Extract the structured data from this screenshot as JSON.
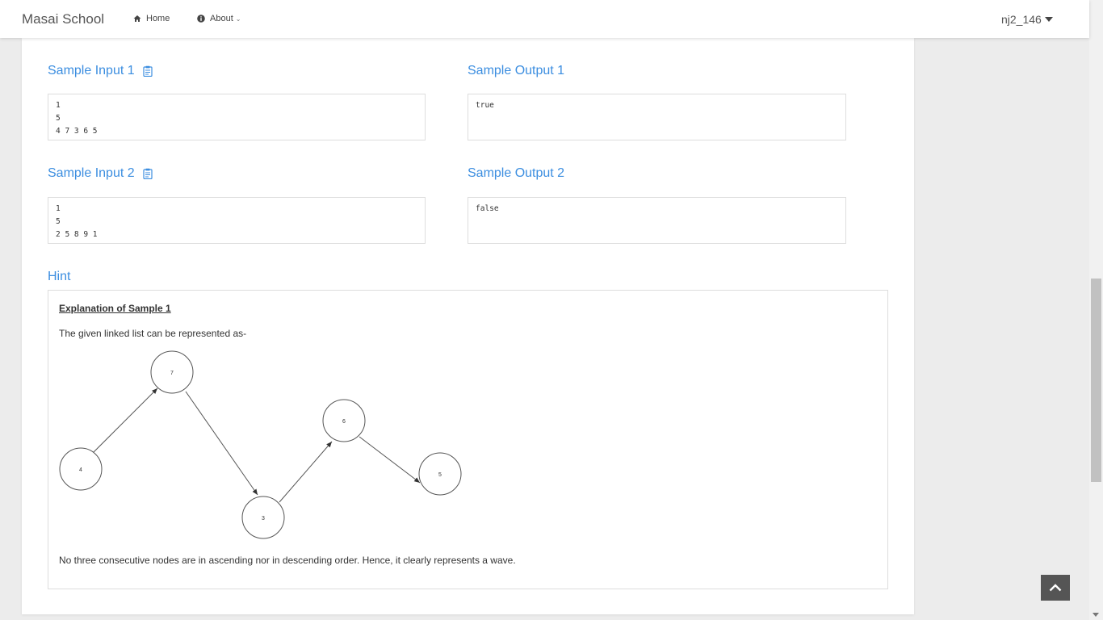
{
  "navbar": {
    "brand": "Masai School",
    "home_label": "Home",
    "about_label": "About",
    "user_label": "nj2_146"
  },
  "samples": [
    {
      "input_title": "Sample Input 1",
      "input_text": "1\n5\n4 7 3 6 5",
      "output_title": "Sample Output 1",
      "output_text": "true"
    },
    {
      "input_title": "Sample Input 2",
      "input_text": "1\n5\n2 5 8 9 1",
      "output_title": "Sample Output 2",
      "output_text": "false"
    }
  ],
  "hint": {
    "title": "Hint",
    "explanation_heading": "Explanation of Sample 1",
    "given_text": "The given linked list can be represented as-",
    "conclusion_text": "No three consecutive nodes are in ascending nor in descending order. Hence, it clearly represents a wave.",
    "nodes": [
      "4",
      "7",
      "3",
      "6",
      "5"
    ]
  },
  "colors": {
    "accent": "#3c8ee0",
    "text": "#333333",
    "to_top_bg": "#555555"
  }
}
